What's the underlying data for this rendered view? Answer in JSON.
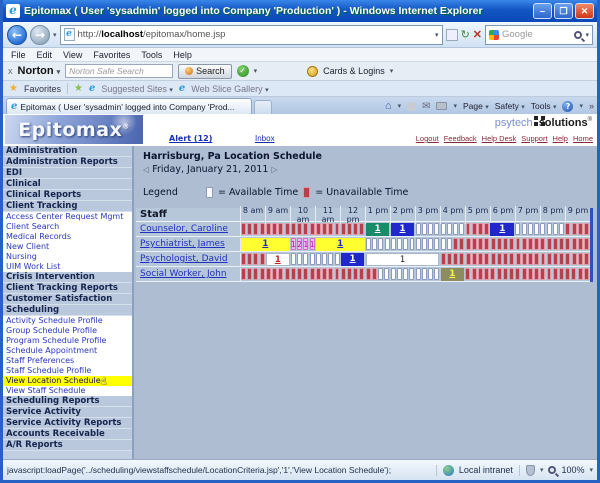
{
  "window": {
    "title": "Epitomax ( User 'sysadmin' logged into Company 'Production' ) - Windows Internet Explorer",
    "url_scheme": "http://",
    "url_host": "localhost",
    "url_path": "/epitomax/home.jsp",
    "menu": [
      "File",
      "Edit",
      "View",
      "Favorites",
      "Tools",
      "Help"
    ],
    "norton": {
      "close": "x",
      "brand": "Norton",
      "search_placeholder": "Norton Safe Search",
      "search_button": "Search",
      "cards_label": "Cards & Logins"
    },
    "favorites": {
      "label": "Favorites",
      "suggested": "Suggested Sites",
      "webslice": "Web Slice Gallery"
    },
    "tab_title": "Epitomax ( User 'sysadmin' logged into Company 'Prod...",
    "command_bar": [
      "Page",
      "Safety",
      "Tools"
    ],
    "search_engine": "Google",
    "status": {
      "left": "javascript:loadPage('../scheduling/viewstaffschedule/LocationCriteria.jsp','1','View Location Schedule');",
      "zone": "Local intranet",
      "zoom": "100%"
    }
  },
  "app": {
    "logo": "Epitomax",
    "logo_reg": "®",
    "alert_link": "Alert (12)",
    "inbox_link": "Inbox",
    "brand_part1": "psytech",
    "brand_part2": "solutions",
    "top_links": [
      "Logout",
      "Feedback",
      "Help Desk",
      "Support",
      "Help",
      "Home"
    ]
  },
  "sidebar": {
    "items": [
      {
        "label": "Administration",
        "type": "category"
      },
      {
        "label": "Administration Reports",
        "type": "category"
      },
      {
        "label": "EDI",
        "type": "category"
      },
      {
        "label": "Clinical",
        "type": "category"
      },
      {
        "label": "Clinical Reports",
        "type": "category"
      },
      {
        "label": "Client Tracking",
        "type": "category"
      },
      {
        "label": "Access Center Request Mgmt",
        "type": "link"
      },
      {
        "label": "Client Search",
        "type": "link"
      },
      {
        "label": "Medical Records",
        "type": "link"
      },
      {
        "label": "New Client",
        "type": "link"
      },
      {
        "label": "Nursing",
        "type": "link"
      },
      {
        "label": "UIM Work List",
        "type": "link"
      },
      {
        "label": "Crisis Intervention",
        "type": "category"
      },
      {
        "label": "Client Tracking Reports",
        "type": "category"
      },
      {
        "label": "Customer Satisfaction",
        "type": "category"
      },
      {
        "label": "Scheduling",
        "type": "category"
      },
      {
        "label": "Activity Schedule Profile",
        "type": "link"
      },
      {
        "label": "Group Schedule Profile",
        "type": "link"
      },
      {
        "label": "Program Schedule Profile",
        "type": "link"
      },
      {
        "label": "Schedule Appointment",
        "type": "link"
      },
      {
        "label": "Staff Preferences",
        "type": "link"
      },
      {
        "label": "Staff Schedule Profile",
        "type": "link"
      },
      {
        "label": "View Location Schedule",
        "type": "link",
        "highlighted": true
      },
      {
        "label": "View Staff Schedule",
        "type": "link"
      },
      {
        "label": "Scheduling Reports",
        "type": "category"
      },
      {
        "label": "Service Activity",
        "type": "category"
      },
      {
        "label": "Service Activity Reports",
        "type": "category"
      },
      {
        "label": "Accounts Receivable",
        "type": "category"
      },
      {
        "label": "A/R Reports",
        "type": "category"
      }
    ]
  },
  "main": {
    "title": "Harrisburg, Pa Location Schedule",
    "date": "Friday, January 21, 2011",
    "prev_arrow": "◁",
    "next_arrow": "▷",
    "legend": {
      "label": "Legend",
      "available": "= Available Time",
      "unavailable": "= Unavailable Time"
    }
  },
  "chart_data": {
    "type": "table",
    "title": "Harrisburg, Pa Location Schedule",
    "date": "Friday, January 21, 2011",
    "staff_header": "Staff",
    "hours": [
      "8 am",
      "9 am",
      "10 am",
      "11 am",
      "12 pm",
      "1 pm",
      "2 pm",
      "3 pm",
      "4 pm",
      "5 pm",
      "6 pm",
      "7 pm",
      "8 pm",
      "9 pm"
    ],
    "slots_per_hour": 4,
    "colors": {
      "unavailable": "#b8404e",
      "available": "#fbfcff",
      "teal": "#1b8a68",
      "blue": "#2028cc",
      "yellow": "#ffff30",
      "pink": "#f8bcf0",
      "olive": "#8c8c5e"
    },
    "rows": [
      {
        "name": "Counselor, Caroline",
        "segments": [
          {
            "kind": "slots",
            "state": "unavailable",
            "count": 20
          },
          {
            "kind": "block",
            "color": "teal",
            "label": "1",
            "span": 4
          },
          {
            "kind": "block",
            "color": "blue",
            "label": "1",
            "span": 4
          },
          {
            "kind": "slots",
            "state": "available",
            "count": 8
          },
          {
            "kind": "slots",
            "state": "unavailable",
            "count": 4
          },
          {
            "kind": "block",
            "color": "blue",
            "label": "1",
            "span": 4
          },
          {
            "kind": "slots",
            "state": "available",
            "count": 8
          },
          {
            "kind": "slots",
            "state": "unavailable",
            "count": 4
          }
        ]
      },
      {
        "name": "Psychiatrist, James",
        "segments": [
          {
            "kind": "block",
            "color": "yellow",
            "label": "1",
            "span": 8
          },
          {
            "kind": "labeled-slots",
            "labels": [
              "1",
              "2",
              "1",
              "1"
            ]
          },
          {
            "kind": "block",
            "color": "yellow",
            "label": "1",
            "span": 8
          },
          {
            "kind": "slots",
            "state": "available",
            "count": 14
          },
          {
            "kind": "slots",
            "state": "unavailable",
            "count": 22
          }
        ]
      },
      {
        "name": "Psychologist, David",
        "segments": [
          {
            "kind": "slots",
            "state": "unavailable",
            "count": 4
          },
          {
            "kind": "block",
            "color": "white-red",
            "label": "1",
            "span": 4
          },
          {
            "kind": "slots",
            "state": "available",
            "count": 8
          },
          {
            "kind": "block",
            "color": "blue",
            "label": "1",
            "span": 4
          },
          {
            "kind": "block",
            "color": "white-black",
            "label": "1",
            "span": 12
          },
          {
            "kind": "slots",
            "state": "unavailable",
            "count": 24
          }
        ]
      },
      {
        "name": "Social Worker, John",
        "segments": [
          {
            "kind": "slots",
            "state": "unavailable",
            "count": 22
          },
          {
            "kind": "slots",
            "state": "available",
            "count": 10
          },
          {
            "kind": "block",
            "color": "olive",
            "label": "1",
            "span": 4
          },
          {
            "kind": "slots",
            "state": "unavailable",
            "count": 20
          }
        ]
      }
    ]
  }
}
